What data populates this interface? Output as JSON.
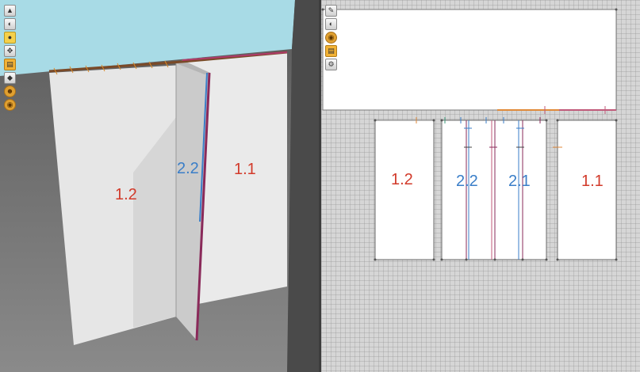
{
  "left_view": {
    "toolbar": {
      "tools": [
        {
          "icon": "mountain-view-icon"
        },
        {
          "icon": "camera-orbit-icon"
        },
        {
          "icon": "camera-zoom-icon"
        },
        {
          "icon": "camera-pan-icon"
        },
        {
          "icon": "note-icon"
        },
        {
          "icon": "shape-icon"
        },
        {
          "icon": "person-icon"
        },
        {
          "icon": "globe-icon"
        }
      ]
    },
    "labels": {
      "panel_1_2": "1.2",
      "panel_2_2": "2.2",
      "panel_1_1": "1.1"
    },
    "colors": {
      "sky": "#a8dbe6",
      "panel": "#e4e4e4",
      "label_red": "#d23a2a",
      "label_blue": "#3a7ec8"
    }
  },
  "right_view": {
    "toolbar": {
      "tools": [
        {
          "icon": "pencil-icon"
        },
        {
          "icon": "camera-orbit-icon"
        },
        {
          "icon": "eye-icon"
        },
        {
          "icon": "note-icon"
        },
        {
          "icon": "settings-icon"
        }
      ]
    },
    "labels": {
      "panel_1_2": "1.2",
      "panel_2_2": "2.2",
      "panel_2_1": "2.1",
      "panel_1_1": "1.1"
    }
  }
}
